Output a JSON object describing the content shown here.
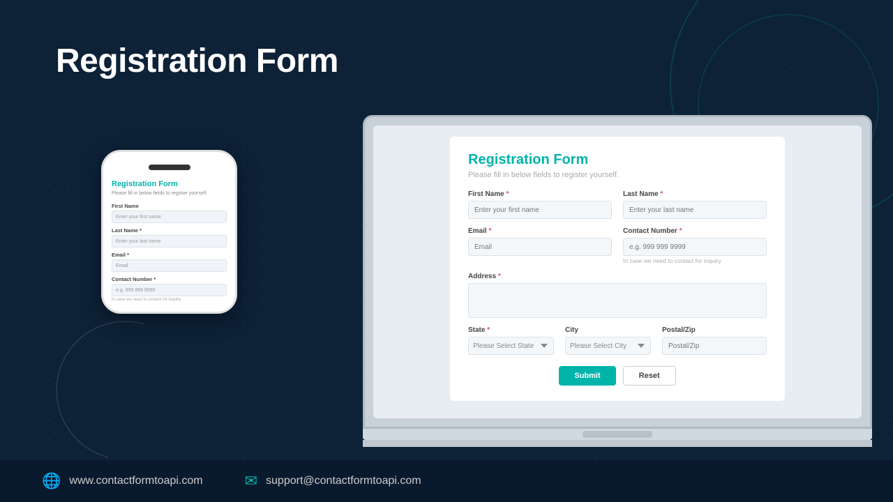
{
  "page": {
    "title": "Registration Form",
    "background_color": "#0d2137"
  },
  "header": {
    "title": "Registration Form"
  },
  "phone_form": {
    "title": "Registration Form",
    "subtitle": "Please fill in below fields to register yourself.",
    "fields": [
      {
        "label": "First Name *",
        "placeholder": "Enter your first name"
      },
      {
        "label": "Last Name *",
        "placeholder": "Enter your last name"
      },
      {
        "label": "Email *",
        "placeholder": "Email"
      },
      {
        "label": "Contact Number *",
        "placeholder": "e.g. 999 999 9999",
        "helper": "In case we need to contact for inquiry"
      }
    ]
  },
  "desktop_form": {
    "title": "Registration Form",
    "subtitle": "Please fill in below fields to register yourself.",
    "fields": {
      "first_name": {
        "label": "First Name",
        "required": true,
        "placeholder": "Enter your first name"
      },
      "last_name": {
        "label": "Last Name",
        "required": true,
        "placeholder": "Enter your last name"
      },
      "email": {
        "label": "Email",
        "required": true,
        "placeholder": "Email"
      },
      "contact_number": {
        "label": "Contact Number",
        "required": true,
        "placeholder": "e.g. 999 999 9999",
        "helper": "In case we need to contact for inquiry"
      },
      "address": {
        "label": "Address",
        "required": true,
        "placeholder": ""
      },
      "state": {
        "label": "State",
        "required": true,
        "placeholder": "Please Select State"
      },
      "city": {
        "label": "City",
        "required": false,
        "placeholder": "Please Select City"
      },
      "postal_zip": {
        "label": "Postal/Zip",
        "required": false,
        "placeholder": "Postal/Zip"
      }
    },
    "buttons": {
      "submit": "Submit",
      "reset": "Reset"
    }
  },
  "footer": {
    "website": "www.contactformtoapi.com",
    "email": "support@contactformtoapi.com"
  }
}
